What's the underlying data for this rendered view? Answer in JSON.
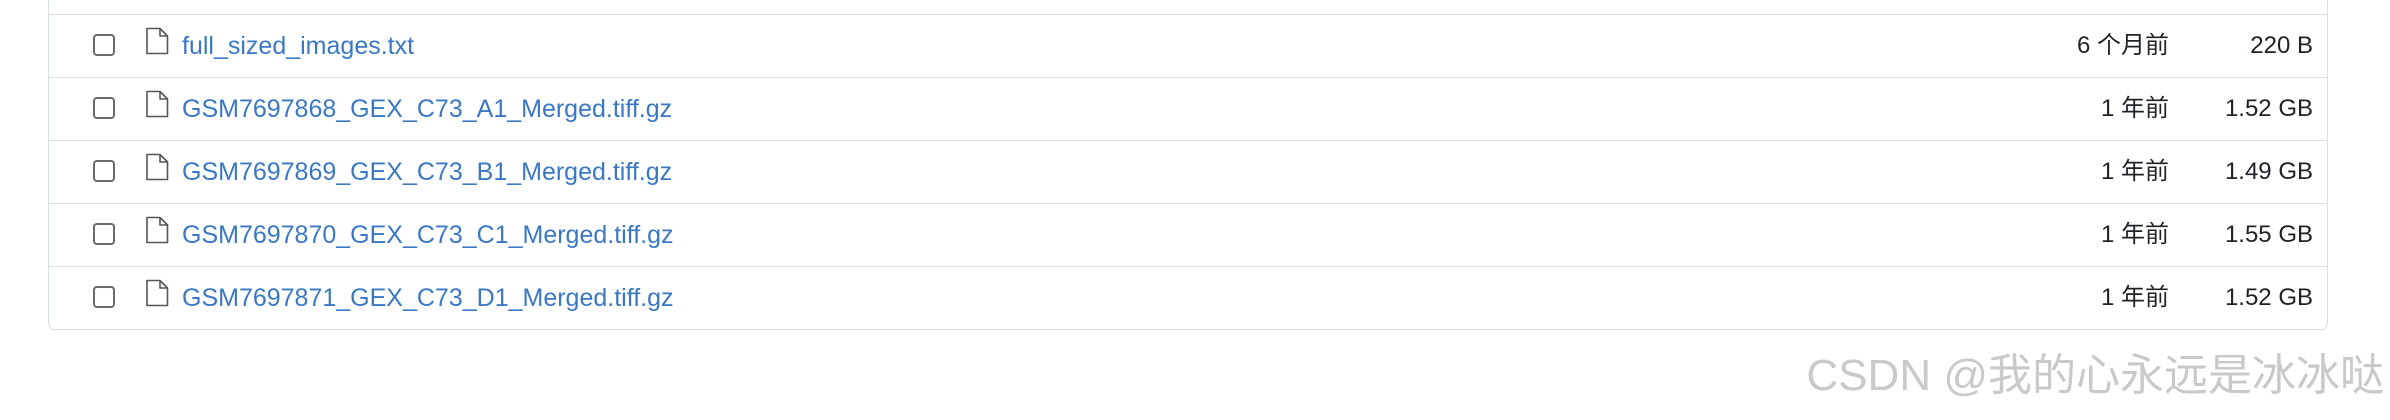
{
  "files": [
    {
      "name": "full_sized_images.txt",
      "modified": "6 个月前",
      "size": "220 B"
    },
    {
      "name": "GSM7697868_GEX_C73_A1_Merged.tiff.gz",
      "modified": "1 年前",
      "size": "1.52 GB"
    },
    {
      "name": "GSM7697869_GEX_C73_B1_Merged.tiff.gz",
      "modified": "1 年前",
      "size": "1.49 GB"
    },
    {
      "name": "GSM7697870_GEX_C73_C1_Merged.tiff.gz",
      "modified": "1 年前",
      "size": "1.55 GB"
    },
    {
      "name": "GSM7697871_GEX_C73_D1_Merged.tiff.gz",
      "modified": "1 年前",
      "size": "1.52 GB"
    }
  ],
  "icons": {
    "file": "file-icon",
    "checkbox": "checkbox-unchecked"
  },
  "colors": {
    "link": "#3a78c3",
    "border": "#d8dee4",
    "text": "#1f2328",
    "watermark": "#c9c9c9"
  },
  "watermark": "CSDN @我的心永远是冰冰哒"
}
